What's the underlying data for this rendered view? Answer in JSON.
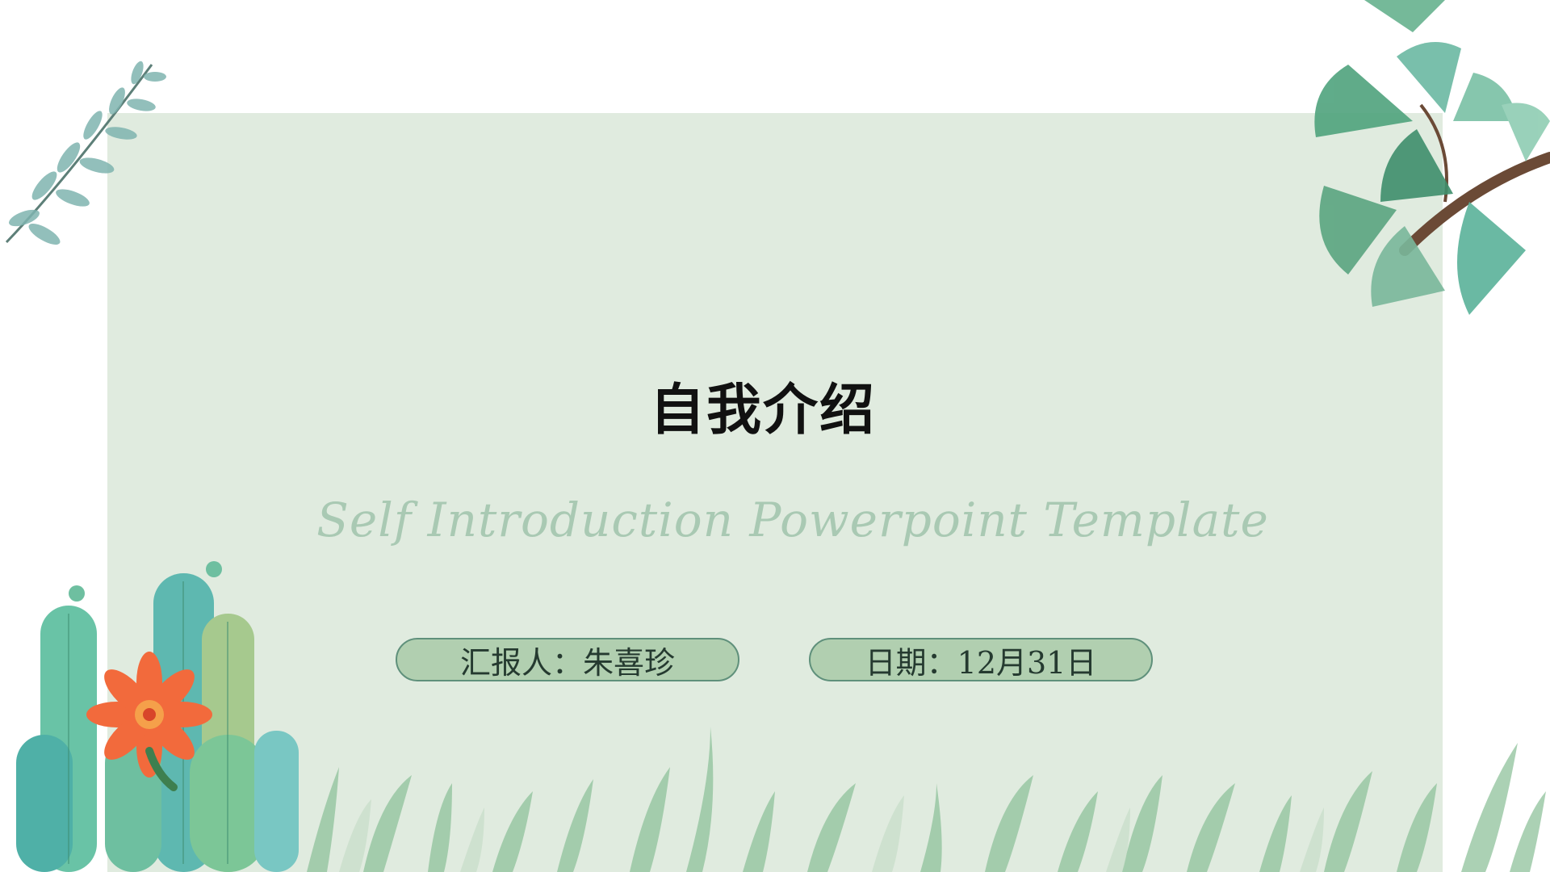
{
  "slide": {
    "title": "自我介绍",
    "subtitle": "Self Introduction Powerpoint Template",
    "reporter": "汇报人：朱喜珍",
    "date": "日期：12月31日"
  },
  "colors": {
    "panel_background": "#e0ebdf",
    "subtitle_color": "#a9c9b3",
    "pill_fill": "#b1cfb0",
    "pill_border": "#5f907b",
    "leaf_green": "#5fa98c",
    "flower_orange": "#f26a3c"
  },
  "decorations": {
    "top_left": "eucalyptus-sprig-icon",
    "top_right": "ginkgo-branch-icon",
    "bottom_left": "cactus-with-flower-icon",
    "bottom": "grass-leaves-icon"
  }
}
